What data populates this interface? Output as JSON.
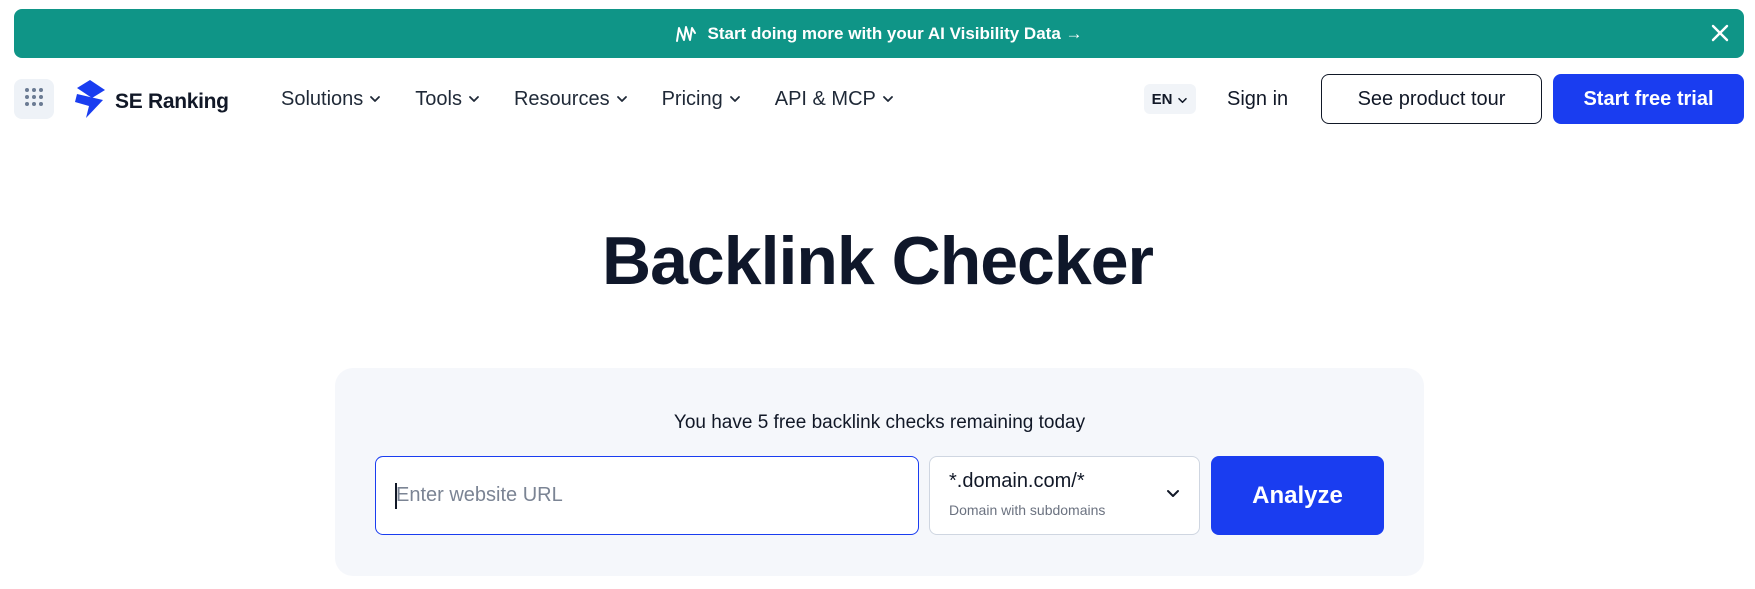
{
  "banner": {
    "text_prefix": "Start doing more with your",
    "text_strong": "AI Visibility Data",
    "arrow": "→",
    "icon": "wave-logo-icon",
    "close_icon": "close-icon",
    "color": "#0f9587"
  },
  "header": {
    "apps_icon": "grid-apps-icon",
    "logo_text": "SE Ranking",
    "nav": [
      {
        "label": "Solutions"
      },
      {
        "label": "Tools"
      },
      {
        "label": "Resources"
      },
      {
        "label": "Pricing"
      },
      {
        "label": "API & MCP"
      }
    ],
    "language": "EN",
    "sign_in": "Sign in",
    "tour_button": "See product tour",
    "trial_button": "Start free trial",
    "accent_color": "#1a3df0"
  },
  "main": {
    "title": "Backlink Checker",
    "remaining_text": "You have 5 free backlink checks remaining today",
    "url_input": {
      "placeholder": "Enter website URL",
      "value": ""
    },
    "scope_select": {
      "value": "*.domain.com/*",
      "description": "Domain with subdomains"
    },
    "analyze_button": "Analyze"
  }
}
